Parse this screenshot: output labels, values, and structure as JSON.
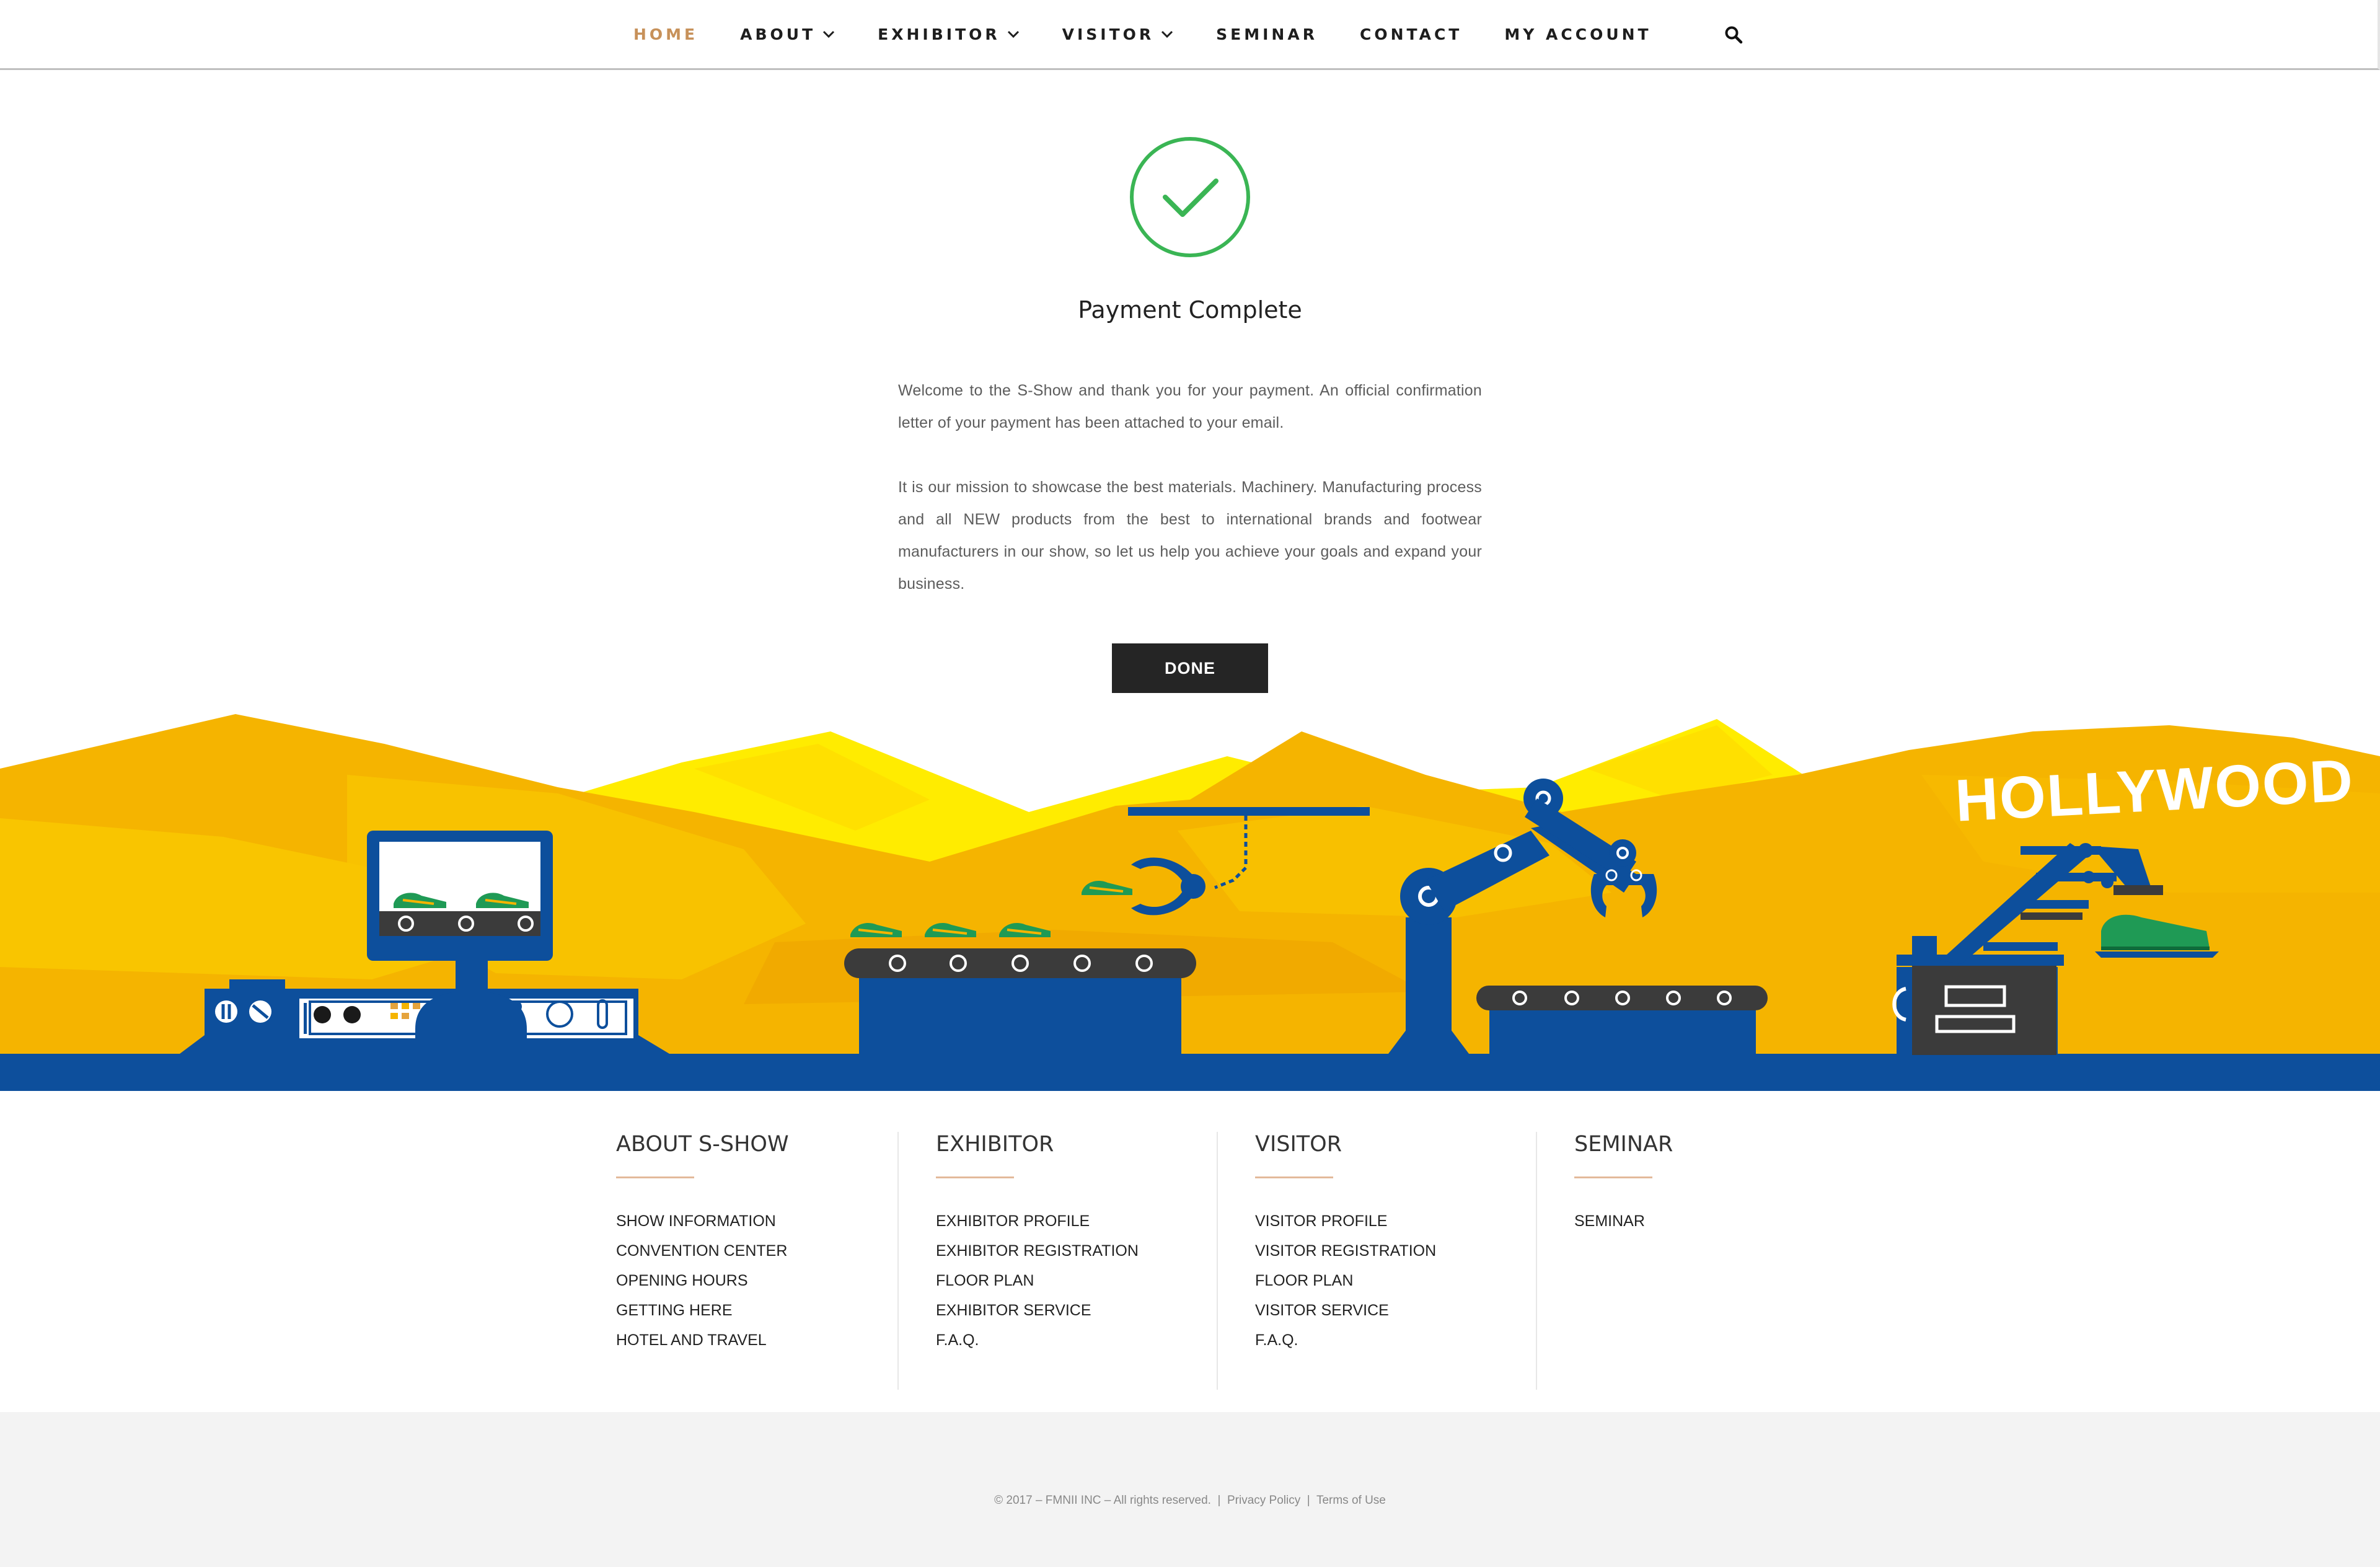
{
  "nav": {
    "items": [
      {
        "label": "HOME",
        "active": true,
        "dropdown": false
      },
      {
        "label": "ABOUT",
        "active": false,
        "dropdown": true
      },
      {
        "label": "EXHIBITOR",
        "active": false,
        "dropdown": true
      },
      {
        "label": "VISITOR",
        "active": false,
        "dropdown": true
      },
      {
        "label": "SEMINAR",
        "active": false,
        "dropdown": false
      },
      {
        "label": "CONTACT",
        "active": false,
        "dropdown": false
      },
      {
        "label": "MY ACCOUNT",
        "active": false,
        "dropdown": false
      }
    ],
    "search_icon": "search-icon",
    "accent_color": "#c7915a"
  },
  "main": {
    "check_icon": "check-circle-icon",
    "check_color": "#3ab554",
    "title": "Payment Complete",
    "paragraph1": "Welcome to the S-Show and thank you for your payment. An official confirmation letter of your payment has been attached to your email.",
    "paragraph2": "It is our mission to showcase the best materials. Machinery. Manufacturing process and all NEW products from the best to international brands and footwear manufacturers in our show, so let us help you achieve your goals and expand your business.",
    "done_label": "DONE"
  },
  "hero": {
    "sign_text": "HOLLYWOOD",
    "colors": {
      "yellow": "#ffd400",
      "orange": "#f5b400",
      "blue": "#0d4f9c",
      "green": "#1f9a55"
    }
  },
  "footer": {
    "columns": [
      {
        "title": "ABOUT S-SHOW",
        "links": [
          "SHOW INFORMATION",
          "CONVENTION CENTER",
          "OPENING HOURS",
          "GETTING HERE",
          "HOTEL AND TRAVEL"
        ]
      },
      {
        "title": "EXHIBITOR",
        "links": [
          "EXHIBITOR PROFILE",
          "EXHIBITOR REGISTRATION",
          "FLOOR PLAN",
          "EXHIBITOR SERVICE",
          "F.A.Q."
        ]
      },
      {
        "title": "VISITOR",
        "links": [
          "VISITOR PROFILE",
          "VISITOR REGISTRATION",
          "FLOOR PLAN",
          "VISITOR SERVICE",
          "F.A.Q."
        ]
      },
      {
        "title": "SEMINAR",
        "links": [
          "SEMINAR"
        ]
      }
    ],
    "underline_color": "#e3b99a",
    "copyright": "© 2017 – FMNII INC – All rights reserved.",
    "sep": "|",
    "privacy": "Privacy Policy",
    "terms": "Terms of Use"
  }
}
